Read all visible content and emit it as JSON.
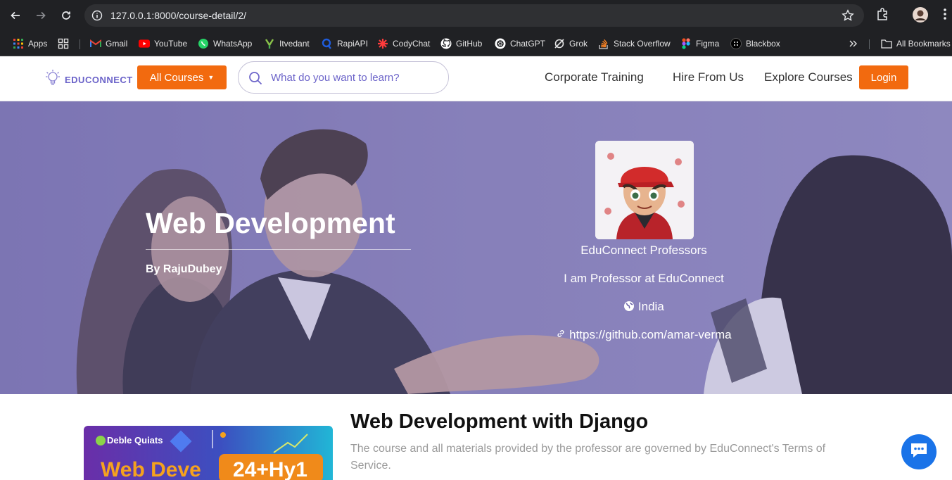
{
  "browser": {
    "url": "127.0.0.1:8000/course-detail/2/",
    "bookmarks": [
      {
        "label": "Apps",
        "icon": "apps-grid-icon"
      },
      {
        "label": "Gmail",
        "icon": "gmail-icon"
      },
      {
        "label": "YouTube",
        "icon": "youtube-icon"
      },
      {
        "label": "WhatsApp",
        "icon": "whatsapp-icon"
      },
      {
        "label": "Itvedant",
        "icon": "itvedant-icon"
      },
      {
        "label": "RapiAPI",
        "icon": "rapidapi-icon"
      },
      {
        "label": "CodyChat",
        "icon": "codychat-icon"
      },
      {
        "label": "GitHub",
        "icon": "github-icon"
      },
      {
        "label": "ChatGPT",
        "icon": "chatgpt-icon"
      },
      {
        "label": "Grok",
        "icon": "grok-icon"
      },
      {
        "label": "Stack Overflow",
        "icon": "stackoverflow-icon"
      },
      {
        "label": "Figma",
        "icon": "figma-icon"
      },
      {
        "label": "Blackbox",
        "icon": "blackbox-icon"
      }
    ],
    "all_bookmarks": "All Bookmarks"
  },
  "header": {
    "logo": "EDUCONNECT",
    "all_courses": "All Courses",
    "search_placeholder": "What do you want to learn?",
    "nav": [
      "Corporate Training",
      "Hire From Us",
      "Explore Courses"
    ],
    "login": "Login"
  },
  "hero": {
    "title": "Web Development",
    "author": "By RajuDubey",
    "professor": {
      "name": "EduConnect Professors",
      "bio": "I am Professor at EduConnect",
      "country": "India",
      "link": "https://github.com/amar-verma"
    }
  },
  "course": {
    "title": "Web Development with Django",
    "description": "The course and all materials provided by the professor are governed by EduConnect's Terms of Service.",
    "thumbnail": {
      "brand": "Deble Quiats",
      "headline": "Web Deve",
      "badge": "24+Hy1"
    }
  },
  "colors": {
    "accent": "#f26a0f",
    "brand": "#6b63c9",
    "chrome": "#202124",
    "chat": "#1a73e8"
  }
}
